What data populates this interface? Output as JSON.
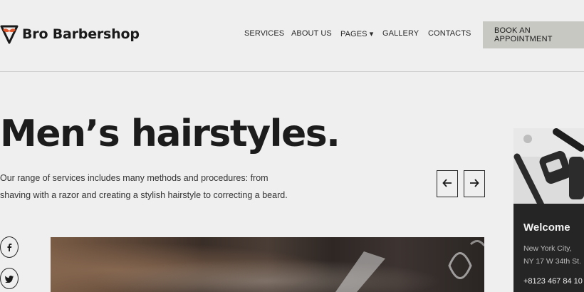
{
  "brand": {
    "name": "Bro Barbershop",
    "accent_color": "#e2572b"
  },
  "nav": {
    "items": [
      {
        "label": "SERVICES"
      },
      {
        "label": "ABOUT US"
      },
      {
        "label": "PAGES ▾"
      },
      {
        "label": "GALLERY"
      },
      {
        "label": "CONTACTS"
      }
    ],
    "cta_label": "BOOK AN APPOINTMENT"
  },
  "hero": {
    "title": "Men’s hairstyles.",
    "description_line1": "Our range of services includes many methods and procedures: from",
    "description_line2": "shaving with a razor and creating a stylish hairstyle to correcting a beard."
  },
  "slider": {
    "prev_icon": "arrow-left-icon",
    "next_icon": "arrow-right-icon"
  },
  "social": [
    {
      "icon": "facebook-icon"
    },
    {
      "icon": "twitter-icon"
    }
  ],
  "sidebar_card": {
    "title": "Welcome",
    "address_line1": "New York City,",
    "address_line2": "NY 17 W 34th St.",
    "phone": "+8123 467 84 10"
  }
}
